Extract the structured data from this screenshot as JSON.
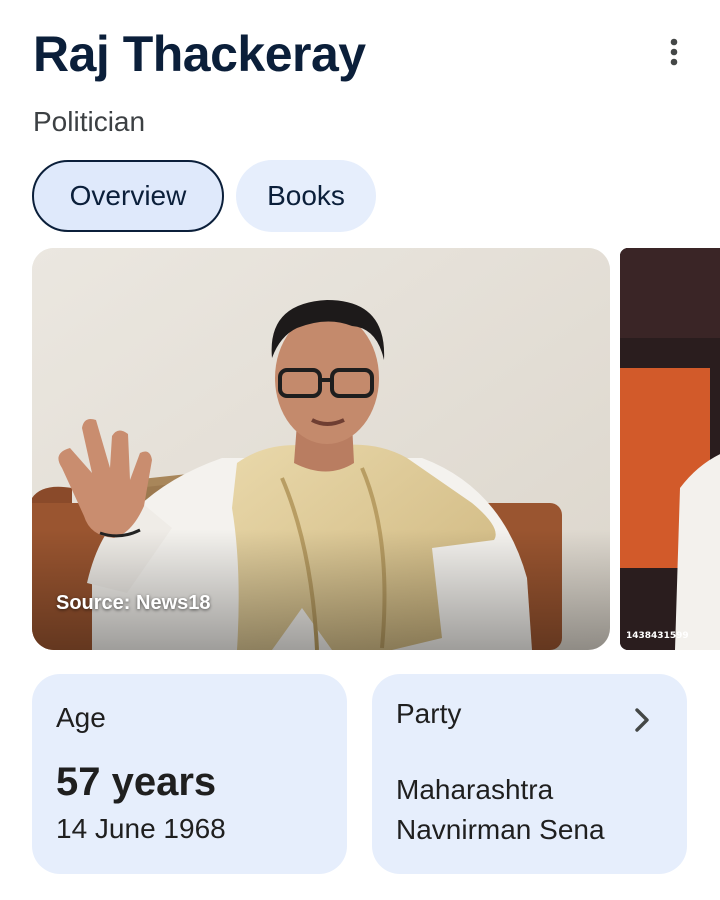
{
  "header": {
    "title": "Raj Thackeray",
    "subtitle": "Politician",
    "menu_icon": "more-vert-icon"
  },
  "tabs": [
    {
      "label": "Overview",
      "active": true
    },
    {
      "label": "Books",
      "active": false
    }
  ],
  "images": {
    "main_source": "Source: News18",
    "next_watermark": "1438431599"
  },
  "cards": {
    "age": {
      "label": "Age",
      "value": "57 years",
      "date": "14 June 1968"
    },
    "party": {
      "label": "Party",
      "value_line1": "Maharashtra",
      "value_line2": "Navnirman Sena",
      "chevron_icon": "chevron-right-icon"
    }
  },
  "colors": {
    "title": "#0b1f3a",
    "chip_active_bg": "#dfe9fb",
    "chip_bg": "#e6eefc",
    "card_bg": "#e6eefc"
  }
}
